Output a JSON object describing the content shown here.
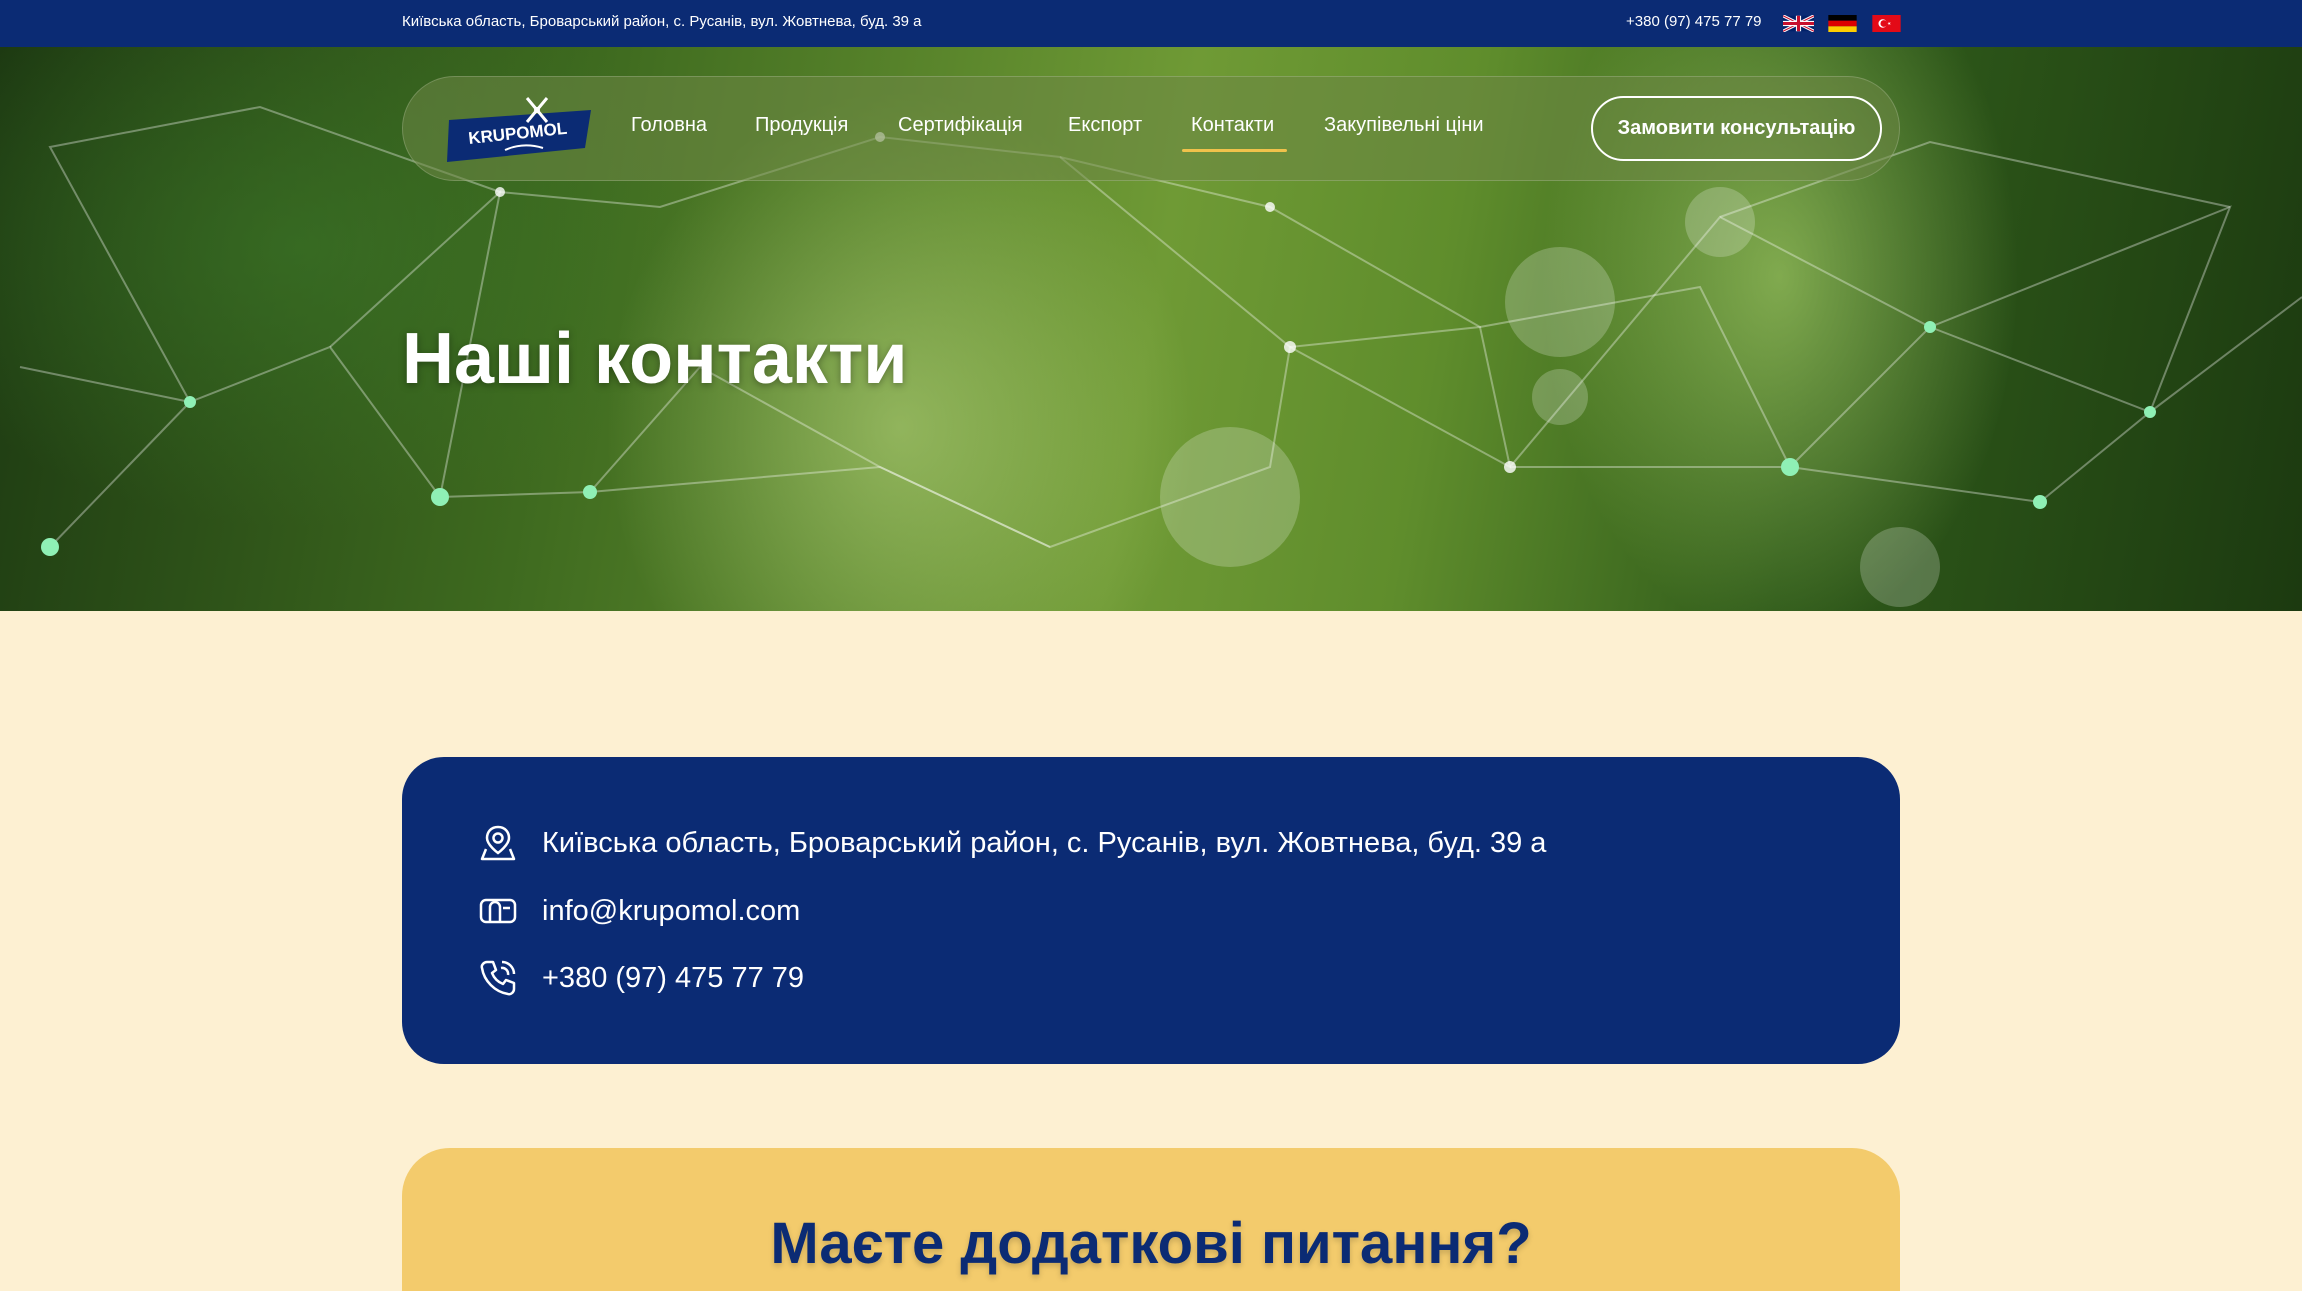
{
  "topbar": {
    "address": "Київська область, Броварський район, с. Русанів, вул. Жовтнева, буд. 39 а",
    "phone": "+380 (97) 475 77 79",
    "languages": [
      "en-flag-icon",
      "de-flag-icon",
      "tr-flag-icon"
    ]
  },
  "header": {
    "logo_text": "KRUPOMOL",
    "nav": [
      {
        "label": "Головна",
        "active": false
      },
      {
        "label": "Продукція",
        "active": false
      },
      {
        "label": "Сертифікація",
        "active": false
      },
      {
        "label": "Експорт",
        "active": false
      },
      {
        "label": "Контакти",
        "active": true
      },
      {
        "label": "Закупівельні ціни",
        "active": false
      }
    ],
    "consult_button": "Замовити консультацію"
  },
  "hero": {
    "title": "Наші контакти"
  },
  "contacts": {
    "address": "Київська область, Броварський район, с. Русанів, вул. Жовтнева, буд. 39 а",
    "email": "info@krupomol.com",
    "phone": "+380 (97) 475 77 79"
  },
  "question": {
    "title": "Маєте додаткові питання?"
  },
  "colors": {
    "brand_navy": "#0b2b74",
    "accent_yellow": "#f3cb6c",
    "page_bg": "#fdf0d2",
    "nav_underline": "#f0c24b"
  }
}
